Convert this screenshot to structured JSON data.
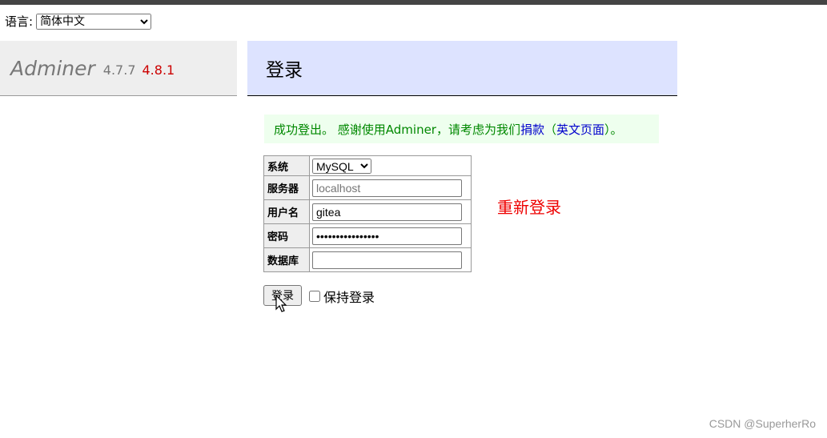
{
  "language": {
    "label": "语言:",
    "selected": "简体中文"
  },
  "brand": {
    "name": "Adminer",
    "version_current": "4.7.7",
    "version_new": "4.8.1"
  },
  "page": {
    "title": "登录"
  },
  "message": {
    "text": "成功登出。 感谢使用Adminer，请考虑为我们",
    "link1": "捐款",
    "mid": "（",
    "link2": "英文页面",
    "end": "）。"
  },
  "form": {
    "system_label": "系统",
    "system_value": "MySQL",
    "server_label": "服务器",
    "server_placeholder": "localhost",
    "username_label": "用户名",
    "username_value": "gitea",
    "password_label": "密码",
    "password_value": "••••••••••••••••",
    "database_label": "数据库",
    "database_value": "",
    "submit_label": "登录",
    "remember_label": "保持登录"
  },
  "annotation": "重新登录",
  "watermark": "CSDN @SuperherRo",
  "colors": {
    "header_bg": "#dde3ff",
    "message_bg": "#eeffee",
    "message_text": "#008800",
    "annotation": "#ee0000",
    "new_version": "#cc0000"
  }
}
